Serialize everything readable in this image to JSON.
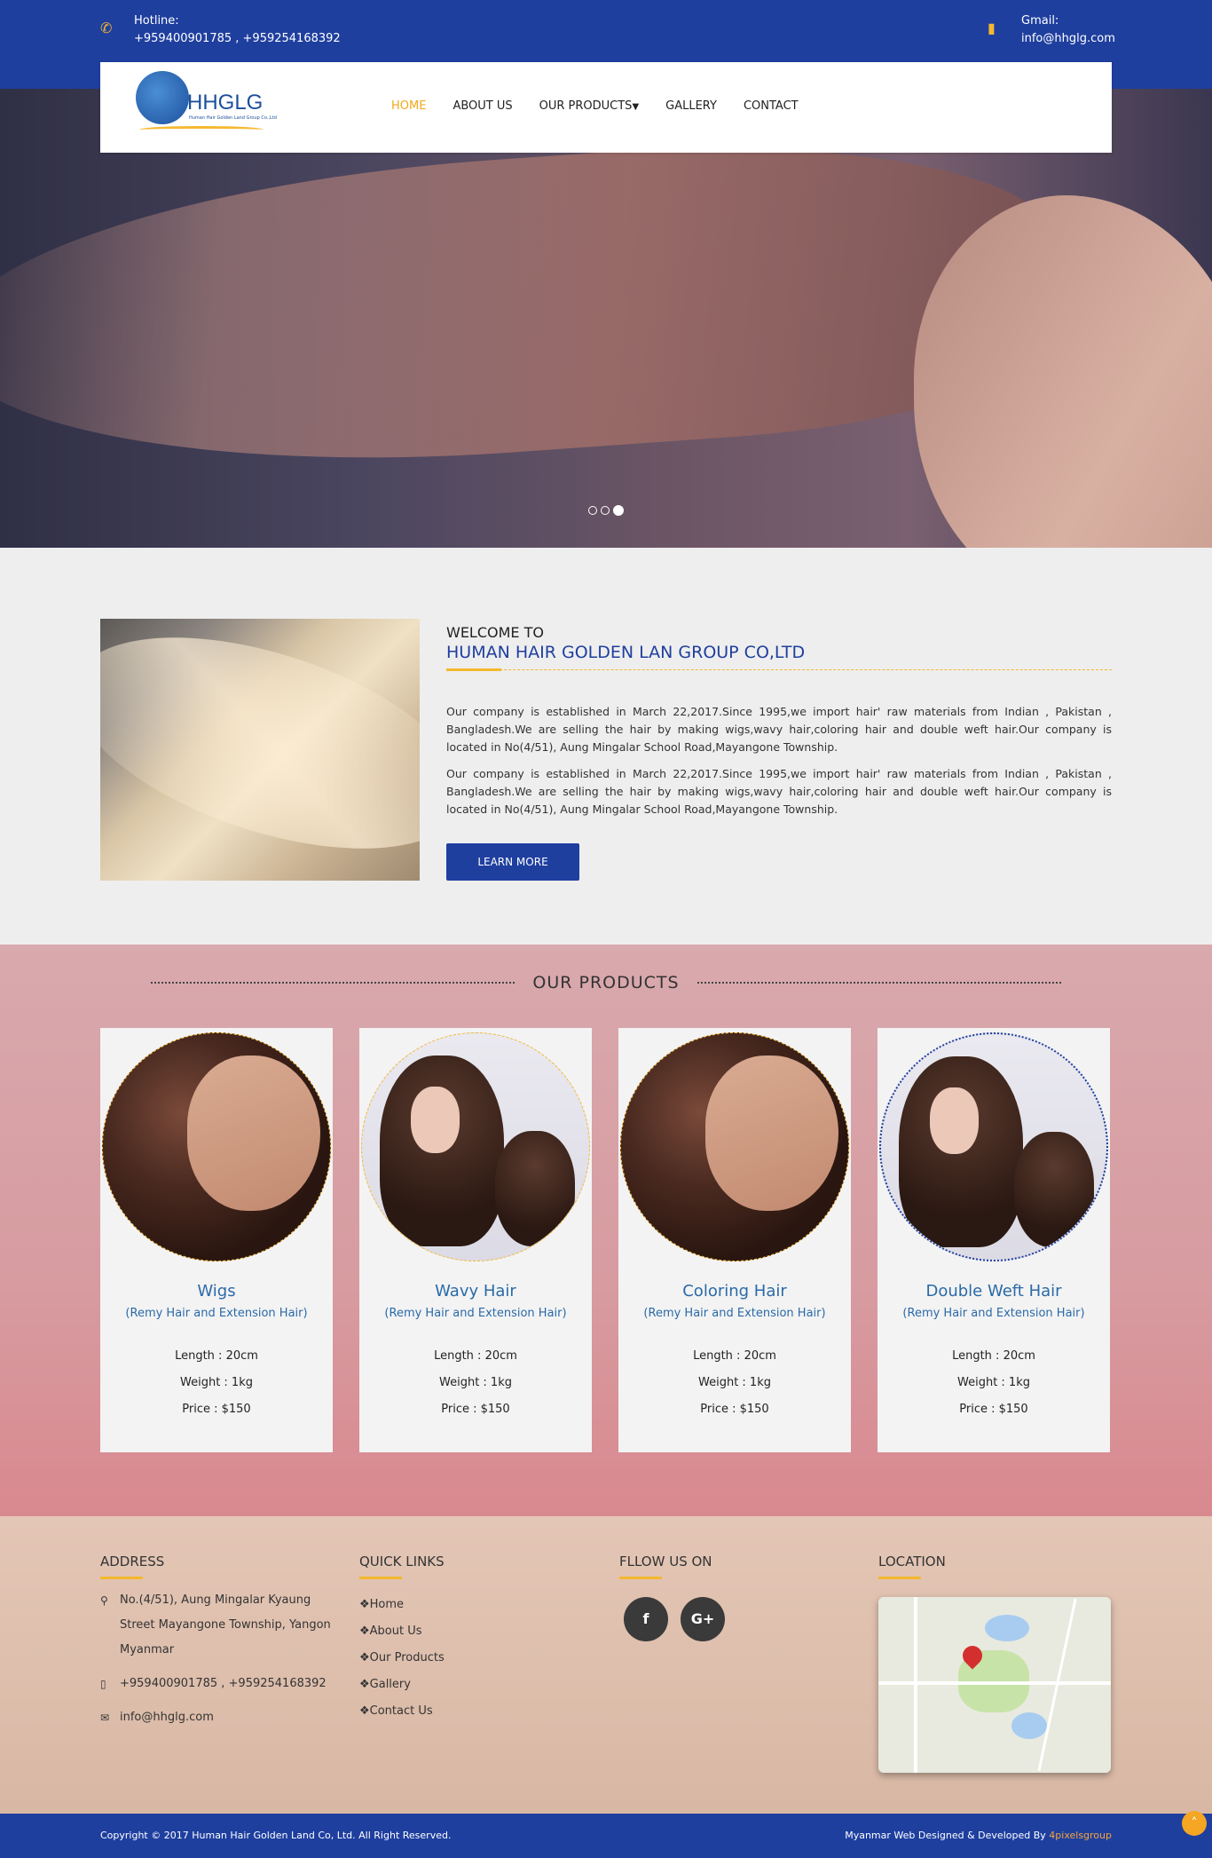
{
  "topbar": {
    "hotline_label": "Hotline:",
    "hotline_value": "+959400901785 , +959254168392",
    "email_label": "Gmail:",
    "email_value": "info@hhglg.com"
  },
  "logo": {
    "name": "HHGLG",
    "tagline": "Human Hair Golden Land Group Co.,Ltd"
  },
  "nav": {
    "items": [
      "HOME",
      "ABOUT US",
      "OUR PRODUCTS",
      "GALLERY",
      "CONTACT"
    ],
    "active": "HOME"
  },
  "welcome": {
    "subtitle": "WELCOME TO",
    "title": "HUMAN HAIR GOLDEN LAN GROUP CO,LTD",
    "paragraph1": "Our company is established in March 22,2017.Since 1995,we import hair' raw materials from Indian , Pakistan , Bangladesh.We are selling the hair by making wigs,wavy hair,coloring hair and double weft hair.Our company is located in No(4/51), Aung Mingalar School Road,Mayangone Township.",
    "paragraph2": "Our company is established in March 22,2017.Since 1995,we import hair' raw materials from Indian , Pakistan , Bangladesh.We are selling the hair by making wigs,wavy hair,coloring hair and double weft hair.Our company is located in No(4/51), Aung Mingalar School Road,Mayangone Township.",
    "button": "LEARN MORE"
  },
  "products": {
    "heading": "OUR PRODUCTS",
    "items": [
      {
        "name": "Wigs",
        "sub": "(Remy Hair and Extension Hair)",
        "length": "Length : 20cm",
        "weight": "Weight : 1kg",
        "price": "Price : $150"
      },
      {
        "name": "Wavy Hair",
        "sub": "(Remy Hair and Extension Hair)",
        "length": "Length : 20cm",
        "weight": "Weight : 1kg",
        "price": "Price : $150"
      },
      {
        "name": "Coloring Hair",
        "sub": "(Remy Hair and Extension Hair)",
        "length": "Length : 20cm",
        "weight": "Weight : 1kg",
        "price": "Price : $150"
      },
      {
        "name": "Double Weft Hair",
        "sub": "(Remy Hair and Extension Hair)",
        "length": "Length : 20cm",
        "weight": "Weight : 1kg",
        "price": "Price : $150"
      }
    ]
  },
  "footer": {
    "address_heading": "ADDRESS",
    "address_lines": [
      "No.(4/51), Aung Mingalar Kyaung Street Mayangone Township, Yangon Myanmar"
    ],
    "phone": "+959400901785 , +959254168392",
    "email": "info@hhglg.com",
    "links_heading": "QUICK LINKS",
    "links": [
      "❖Home",
      "❖About Us",
      "❖Our Products",
      "❖Gallery",
      "❖Contact Us"
    ],
    "follow_heading": "FLLOW US ON",
    "social": [
      {
        "icon": "facebook-icon",
        "glyph": "f"
      },
      {
        "icon": "google-plus-icon",
        "glyph": "G+"
      }
    ],
    "location_heading": "LOCATION"
  },
  "bottombar": {
    "copyright": "Copyright © 2017 Human Hair Golden Land Co, Ltd. All Right Reserved.",
    "developed_prefix": "Myanmar Web Designed & Developed By ",
    "developer": "4pixelsgroup"
  },
  "colors": {
    "primary": "#1f3f9f",
    "accent": "#f5b82e",
    "product_title": "#2a6aa8"
  }
}
